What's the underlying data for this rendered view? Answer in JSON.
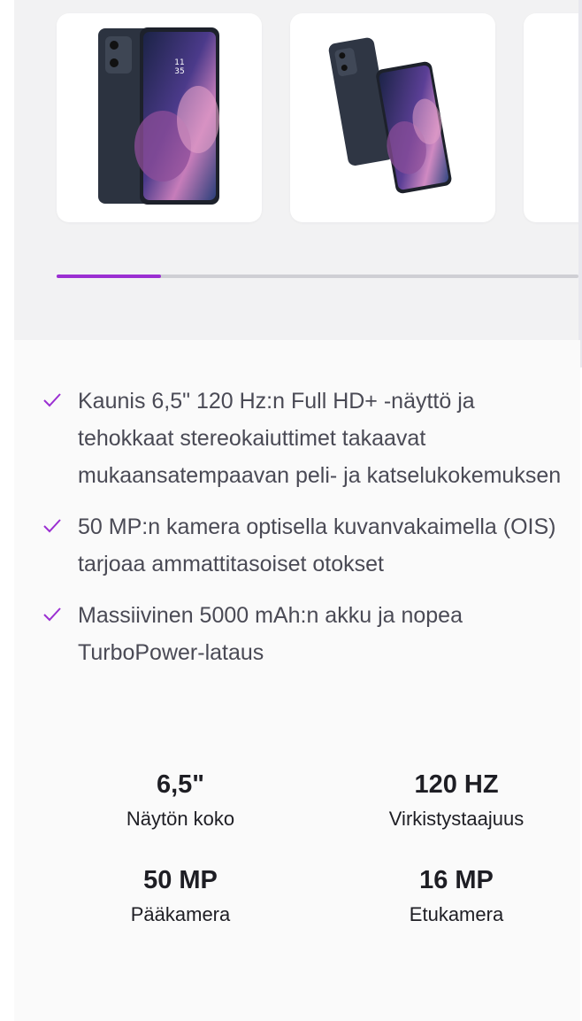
{
  "gallery": {
    "images": [
      {
        "alt": "phone-front",
        "icon": "phone-front-image"
      },
      {
        "alt": "phone-angled-pair",
        "icon": "phone-pair-image"
      },
      {
        "alt": "phone-partial",
        "icon": "phone-partial-image"
      }
    ],
    "progress": 0.2,
    "accent_color": "#9b2fd2"
  },
  "features": [
    {
      "text": "Kaunis 6,5\" 120 Hz:n Full HD+ -näyttö ja tehokkaat stereokaiuttimet takaavat mukaansatempaavan peli- ja katselukokemuksen",
      "icon": "check-icon"
    },
    {
      "text": "50 MP:n kamera optisella kuvanvakaimella (OIS) tarjoaa ammattitasoiset otokset",
      "icon": "check-icon"
    },
    {
      "text": "Massiivinen 5000 mAh:n akku ja nopea TurboPower-lataus",
      "icon": "check-icon"
    }
  ],
  "specs": [
    {
      "value": "6,5\"",
      "label": "Näytön koko"
    },
    {
      "value": "120 HZ",
      "label": "Virkistystaajuus"
    },
    {
      "value": "50 MP",
      "label": "Pääkamera"
    },
    {
      "value": "16 MP",
      "label": "Etukamera"
    }
  ]
}
